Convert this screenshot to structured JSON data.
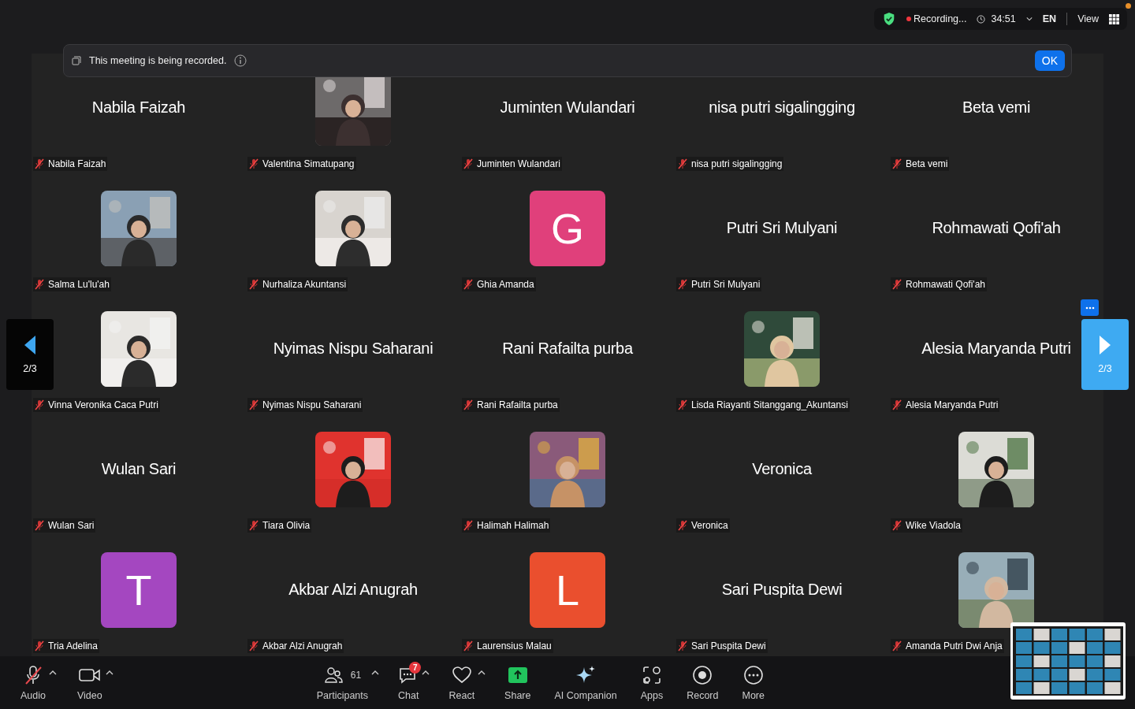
{
  "status_bar": {
    "recording": "Recording...",
    "timer": "34:51",
    "language": "EN",
    "view": "View"
  },
  "banner": {
    "text": "This meeting is being recorded.",
    "button": "OK"
  },
  "pager": {
    "previous": "2/3",
    "next": "2/3"
  },
  "tiles": [
    {
      "kind": "name",
      "name": "Nabila Faizah",
      "label": "Nabila Faizah",
      "muted": true
    },
    {
      "kind": "picture",
      "label": "Valentina Simatupang",
      "muted": true
    },
    {
      "kind": "name",
      "name": "Juminten Wulandari",
      "label": "Juminten Wulandari",
      "muted": true
    },
    {
      "kind": "name",
      "name": "nisa putri sigalingging",
      "label": "nisa putri sigalingging",
      "muted": true
    },
    {
      "kind": "name",
      "name": "Beta vemi",
      "label": "Beta vemi",
      "muted": true
    },
    {
      "kind": "picture",
      "label": "Salma Lu'lu'ah",
      "muted": true
    },
    {
      "kind": "picture",
      "label": "Nurhaliza Akuntansi",
      "muted": true
    },
    {
      "kind": "letter",
      "letter": "G",
      "color": "#e0407b",
      "label": "Ghia Amanda",
      "muted": true
    },
    {
      "kind": "name",
      "name": "Putri Sri Mulyani",
      "label": "Putri Sri Mulyani",
      "muted": true
    },
    {
      "kind": "name",
      "name": "Rohmawati Qofi'ah",
      "label": "Rohmawati Qofi'ah",
      "muted": true
    },
    {
      "kind": "picture",
      "label": "Vinna Veronika Caca Putri",
      "muted": true
    },
    {
      "kind": "name",
      "name": "Nyimas Nispu Saharani",
      "label": "Nyimas Nispu Saharani",
      "muted": true
    },
    {
      "kind": "name",
      "name": "Rani Rafailta purba",
      "label": "Rani Rafailta purba",
      "muted": true
    },
    {
      "kind": "picture",
      "label": "Lisda Riayanti Sitanggang_Akuntansi",
      "muted": true
    },
    {
      "kind": "name",
      "name": "Alesia Maryanda Putri",
      "label": "Alesia Maryanda Putri",
      "muted": true
    },
    {
      "kind": "name",
      "name": "Wulan Sari",
      "label": "Wulan Sari",
      "muted": true
    },
    {
      "kind": "picture",
      "label": "Tiara Olivia",
      "muted": true
    },
    {
      "kind": "picture",
      "label": "Halimah Halimah",
      "muted": true
    },
    {
      "kind": "name",
      "name": "Veronica",
      "label": "Veronica",
      "muted": true
    },
    {
      "kind": "picture",
      "label": "Wike Viadola",
      "muted": true
    },
    {
      "kind": "letter",
      "letter": "T",
      "color": "#a447c0",
      "label": "Tria Adelina",
      "muted": true
    },
    {
      "kind": "name",
      "name": "Akbar Alzi Anugrah",
      "label": "Akbar Alzi Anugrah",
      "muted": true
    },
    {
      "kind": "letter",
      "letter": "L",
      "color": "#ea4f2e",
      "label": "Laurensius Malau",
      "muted": true
    },
    {
      "kind": "name",
      "name": "Sari Puspita Dewi",
      "label": "Sari Puspita Dewi",
      "muted": true
    },
    {
      "kind": "picture",
      "label": "Amanda Putri Dwi Anja",
      "muted": true
    }
  ],
  "toolbar": [
    {
      "kind": "audio",
      "label": "Audio",
      "muted": true,
      "caret": true
    },
    {
      "kind": "video",
      "label": "Video",
      "caret": true
    },
    {
      "kind": "participants",
      "label": "Participants",
      "count": "61",
      "caret": true
    },
    {
      "kind": "chat",
      "label": "Chat",
      "badge": "7",
      "caret": true
    },
    {
      "kind": "react",
      "label": "React",
      "caret": true
    },
    {
      "kind": "share",
      "label": "Share",
      "caret": false
    },
    {
      "kind": "ai",
      "label": "AI Companion",
      "caret": false
    },
    {
      "kind": "apps",
      "label": "Apps",
      "caret": false
    },
    {
      "kind": "record",
      "label": "Record",
      "caret": false
    },
    {
      "kind": "more",
      "label": "More",
      "caret": false
    }
  ]
}
